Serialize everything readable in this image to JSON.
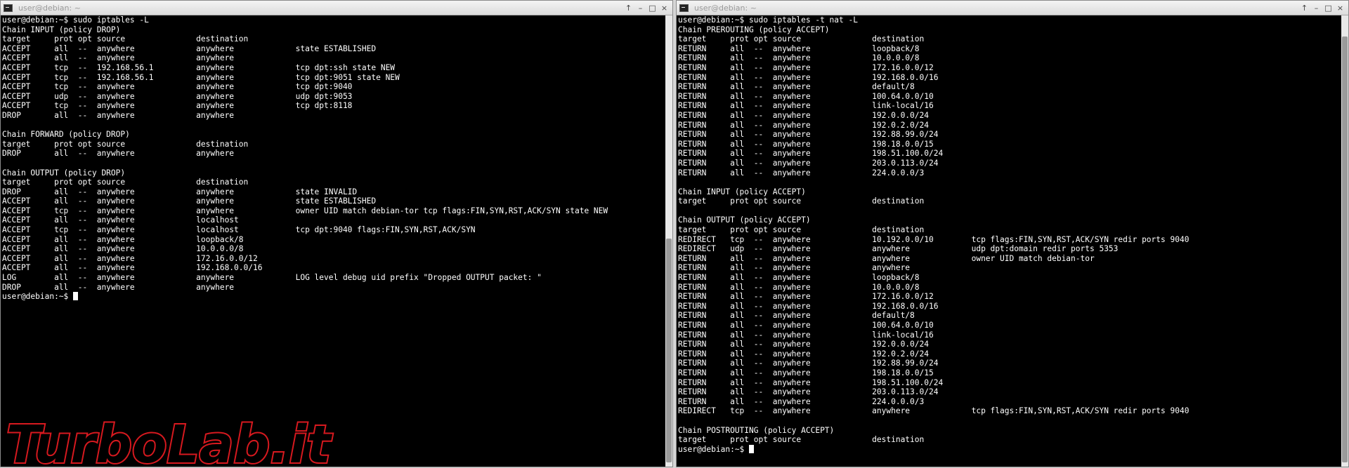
{
  "left_window": {
    "title": "user@debian: ~",
    "controls": {
      "up": "↑",
      "minimize": "–",
      "maximize": "□",
      "close": "×"
    },
    "prompt": "user@debian:~$ ",
    "lines": [
      "user@debian:~$ sudo iptables -L",
      "Chain INPUT (policy DROP)",
      "target     prot opt source               destination",
      "ACCEPT     all  --  anywhere             anywhere             state ESTABLISHED",
      "ACCEPT     all  --  anywhere             anywhere",
      "ACCEPT     tcp  --  192.168.56.1         anywhere             tcp dpt:ssh state NEW",
      "ACCEPT     tcp  --  192.168.56.1         anywhere             tcp dpt:9051 state NEW",
      "ACCEPT     tcp  --  anywhere             anywhere             tcp dpt:9040",
      "ACCEPT     udp  --  anywhere             anywhere             udp dpt:9053",
      "ACCEPT     tcp  --  anywhere             anywhere             tcp dpt:8118",
      "DROP       all  --  anywhere             anywhere",
      "",
      "Chain FORWARD (policy DROP)",
      "target     prot opt source               destination",
      "DROP       all  --  anywhere             anywhere",
      "",
      "Chain OUTPUT (policy DROP)",
      "target     prot opt source               destination",
      "DROP       all  --  anywhere             anywhere             state INVALID",
      "ACCEPT     all  --  anywhere             anywhere             state ESTABLISHED",
      "ACCEPT     tcp  --  anywhere             anywhere             owner UID match debian-tor tcp flags:FIN,SYN,RST,ACK/SYN state NEW",
      "ACCEPT     all  --  anywhere             localhost",
      "ACCEPT     tcp  --  anywhere             localhost            tcp dpt:9040 flags:FIN,SYN,RST,ACK/SYN",
      "ACCEPT     all  --  anywhere             loopback/8",
      "ACCEPT     all  --  anywhere             10.0.0.0/8",
      "ACCEPT     all  --  anywhere             172.16.0.0/12",
      "ACCEPT     all  --  anywhere             192.168.0.0/16",
      "LOG        all  --  anywhere             anywhere             LOG level debug uid prefix \"Dropped OUTPUT packet: \"",
      "DROP       all  --  anywhere             anywhere"
    ]
  },
  "right_window": {
    "title": "user@debian: ~",
    "controls": {
      "up": "↑",
      "minimize": "–",
      "maximize": "□",
      "close": "×"
    },
    "prompt": "user@debian:~$ ",
    "lines": [
      "user@debian:~$ sudo iptables -t nat -L",
      "Chain PREROUTING (policy ACCEPT)",
      "target     prot opt source               destination",
      "RETURN     all  --  anywhere             loopback/8",
      "RETURN     all  --  anywhere             10.0.0.0/8",
      "RETURN     all  --  anywhere             172.16.0.0/12",
      "RETURN     all  --  anywhere             192.168.0.0/16",
      "RETURN     all  --  anywhere             default/8",
      "RETURN     all  --  anywhere             100.64.0.0/10",
      "RETURN     all  --  anywhere             link-local/16",
      "RETURN     all  --  anywhere             192.0.0.0/24",
      "RETURN     all  --  anywhere             192.0.2.0/24",
      "RETURN     all  --  anywhere             192.88.99.0/24",
      "RETURN     all  --  anywhere             198.18.0.0/15",
      "RETURN     all  --  anywhere             198.51.100.0/24",
      "RETURN     all  --  anywhere             203.0.113.0/24",
      "RETURN     all  --  anywhere             224.0.0.0/3",
      "",
      "Chain INPUT (policy ACCEPT)",
      "target     prot opt source               destination",
      "",
      "Chain OUTPUT (policy ACCEPT)",
      "target     prot opt source               destination",
      "REDIRECT   tcp  --  anywhere             10.192.0.0/10        tcp flags:FIN,SYN,RST,ACK/SYN redir ports 9040",
      "REDIRECT   udp  --  anywhere             anywhere             udp dpt:domain redir ports 5353",
      "RETURN     all  --  anywhere             anywhere             owner UID match debian-tor",
      "RETURN     all  --  anywhere             anywhere",
      "RETURN     all  --  anywhere             loopback/8",
      "RETURN     all  --  anywhere             10.0.0.0/8",
      "RETURN     all  --  anywhere             172.16.0.0/12",
      "RETURN     all  --  anywhere             192.168.0.0/16",
      "RETURN     all  --  anywhere             default/8",
      "RETURN     all  --  anywhere             100.64.0.0/10",
      "RETURN     all  --  anywhere             link-local/16",
      "RETURN     all  --  anywhere             192.0.0.0/24",
      "RETURN     all  --  anywhere             192.0.2.0/24",
      "RETURN     all  --  anywhere             192.88.99.0/24",
      "RETURN     all  --  anywhere             198.18.0.0/15",
      "RETURN     all  --  anywhere             198.51.100.0/24",
      "RETURN     all  --  anywhere             203.0.113.0/24",
      "RETURN     all  --  anywhere             224.0.0.0/3",
      "REDIRECT   tcp  --  anywhere             anywhere             tcp flags:FIN,SYN,RST,ACK/SYN redir ports 9040",
      "",
      "Chain POSTROUTING (policy ACCEPT)",
      "target     prot opt source               destination"
    ]
  },
  "watermark": {
    "text": "TurboLab.it",
    "color_fill": "#000000",
    "color_outline": "#d8191f"
  },
  "colors": {
    "terminal_bg": "#000000",
    "terminal_fg": "#ffffff",
    "titlebar": "#e6e6e6"
  }
}
